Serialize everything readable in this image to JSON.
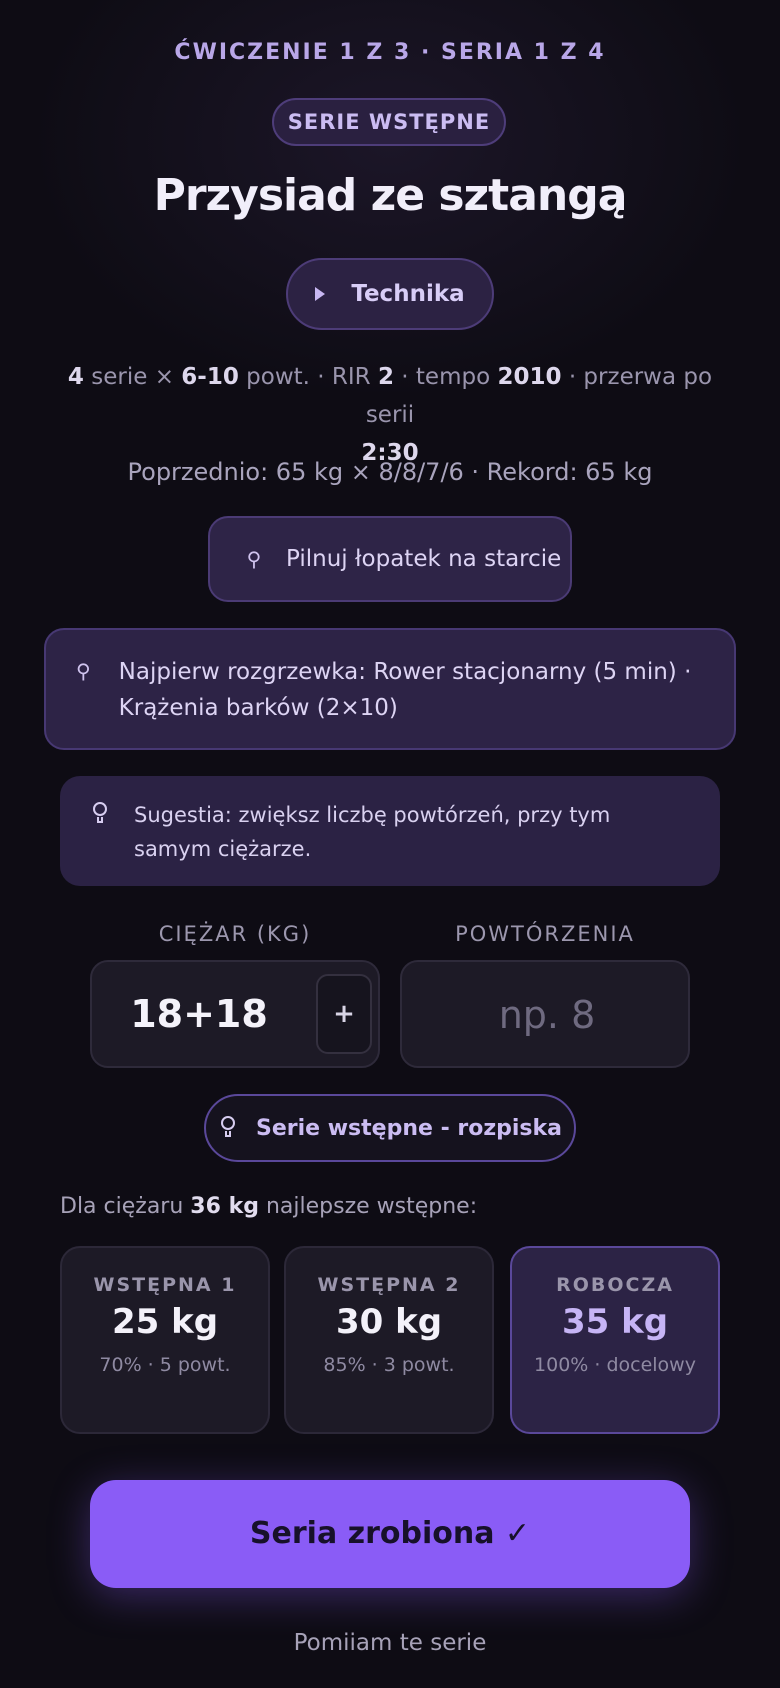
{
  "header": {
    "progress": "ĆWICZENIE 1 Z 3 · SERIA 1 Z 4",
    "badge": "SERIE WSTĘPNE",
    "title": "Przysiad ze sztangą",
    "technique_label": "Technika"
  },
  "params": {
    "sets": "4",
    "sets_unit": "serie ×",
    "reps": "6-10",
    "reps_unit": "powt. · RIR",
    "rir": "2",
    "tempo_label": "· tempo",
    "tempo": "2010",
    "rest_label": "· przerwa po serii",
    "rest": "2:30"
  },
  "previous": "Poprzednio: 65 kg × 8/8/7/6 · Rekord: 65 kg",
  "notes": {
    "pinned_tip": "Pilnuj łopatek na starcie",
    "warmup": "Najpierw rozgrzewka: Rower stacjonarny (5 min) · Krążenia barków (2×10)",
    "suggestion": "Sugestia: zwiększ liczbę powtórzeń, przy tym samym ciężarze."
  },
  "inputs": {
    "weight_label": "CIĘŻAR (KG)",
    "weight_value": "18+18",
    "plus_label": "+",
    "reps_label": "POWTÓRZENIA",
    "reps_placeholder": "np. 8"
  },
  "warmup_plan": {
    "button_label": "Serie wstępne - rozpiska",
    "intro_prefix": "Dla ciężaru",
    "intro_weight": "36 kg",
    "intro_suffix": "najlepsze wstępne:",
    "sets": [
      {
        "name": "WSTĘPNA 1",
        "weight": "25 kg",
        "detail": "70% · 5 powt."
      },
      {
        "name": "WSTĘPNA 2",
        "weight": "30 kg",
        "detail": "85% · 3 powt."
      },
      {
        "name": "ROBOCZA",
        "weight": "35 kg",
        "detail": "100% · docelowy"
      }
    ]
  },
  "actions": {
    "done_label": "Seria zrobiona ✓",
    "skip_label": "Pomiiam te serie"
  },
  "colors": {
    "accent": "#8a5cf6",
    "background": "#0e0c14",
    "card": "#2d2346"
  }
}
